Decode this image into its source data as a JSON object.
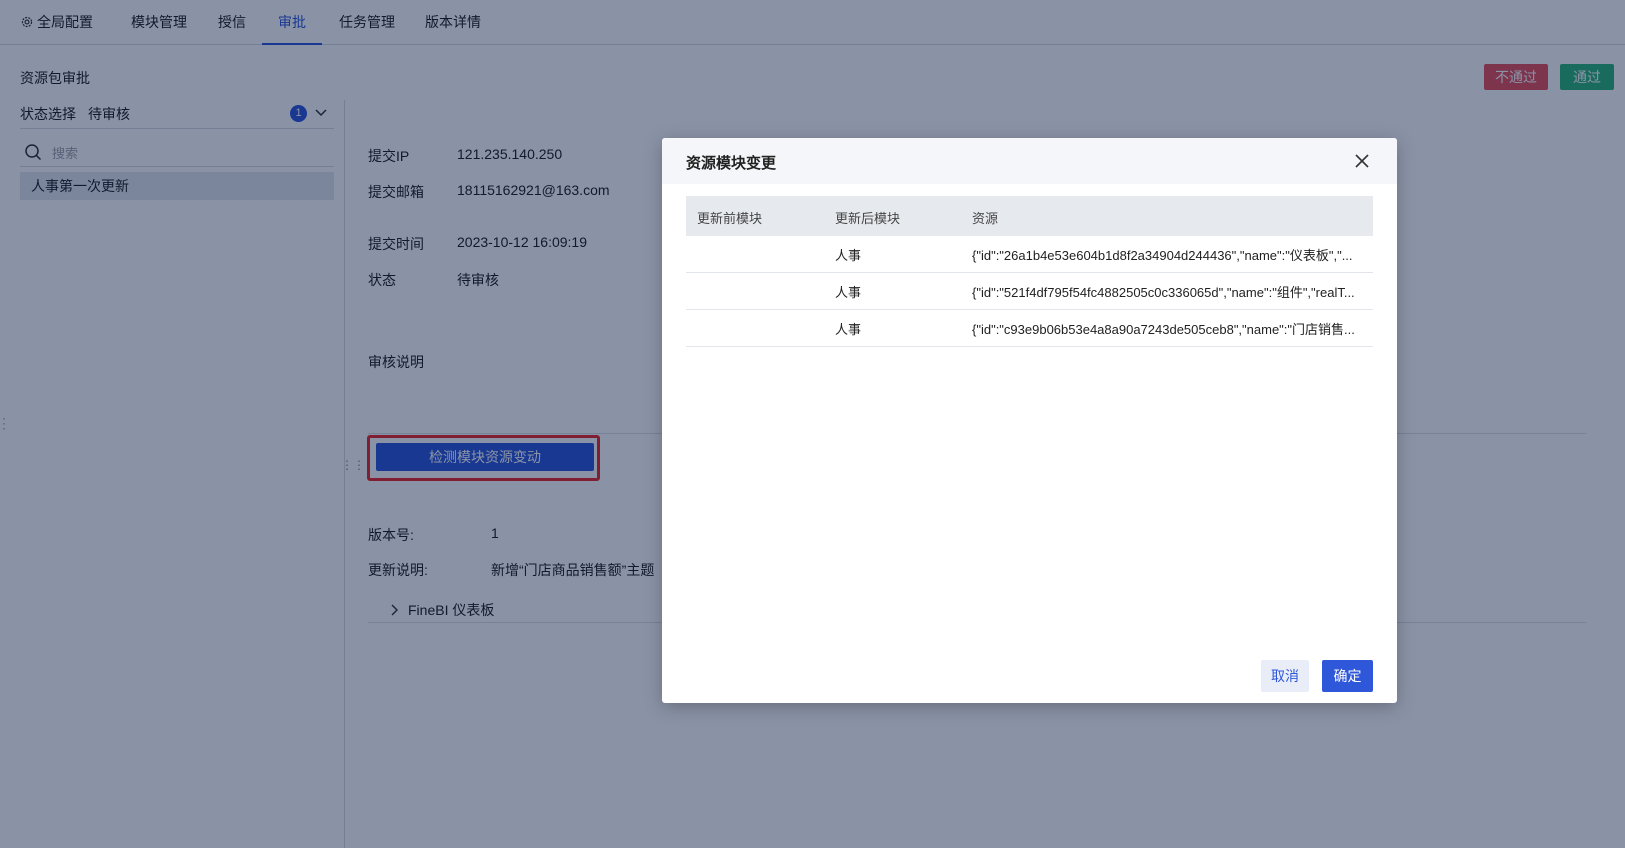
{
  "nav": {
    "global_config": "全局配置",
    "module_mgmt": "模块管理",
    "auth": "授信",
    "approval": "审批",
    "task_mgmt": "任务管理",
    "version_detail": "版本详情"
  },
  "header": {
    "title": "资源包审批",
    "reject_label": "不通过",
    "pass_label": "通过"
  },
  "sidebar": {
    "status_label": "状态选择",
    "status_value": "待审核",
    "status_count": "1",
    "search_placeholder": "搜索",
    "items": [
      {
        "label": "人事第一次更新"
      }
    ]
  },
  "details": {
    "ip_label": "提交IP",
    "ip_value": "121.235.140.250",
    "email_label": "提交邮箱",
    "email_value": "18115162921@163.com",
    "time_label": "提交时间",
    "time_value": "2023-10-12 16:09:19",
    "status_label": "状态",
    "status_value": "待审核",
    "note_label": "审核说明",
    "detect_button": "检测模块资源变动",
    "version_label": "版本号:",
    "version_value": "1",
    "update_note_label": "更新说明:",
    "update_note_value": "新增“门店商品销售额”主题",
    "section_title": "FineBI 仪表板"
  },
  "modal": {
    "title": "资源模块变更",
    "columns": [
      "更新前模块",
      "更新后模块",
      "资源"
    ],
    "rows": [
      {
        "before": "",
        "after": "人事",
        "resource": "{\"id\":\"26a1b4e53e604b1d8f2a34904d244436\",\"name\":\"仪表板\",\"..."
      },
      {
        "before": "",
        "after": "人事",
        "resource": "{\"id\":\"521f4df795f54fc4882505c0c336065d\",\"name\":\"组件\",\"realT..."
      },
      {
        "before": "",
        "after": "人事",
        "resource": "{\"id\":\"c93e9b06b53e4a8a90a7243de505ceb8\",\"name\":\"门店销售..."
      }
    ],
    "cancel_label": "取消",
    "ok_label": "确定"
  },
  "colors": {
    "primary": "#2f57d9",
    "danger": "#e8505b",
    "success": "#2fb57a",
    "highlight": "#ee2a2a"
  }
}
